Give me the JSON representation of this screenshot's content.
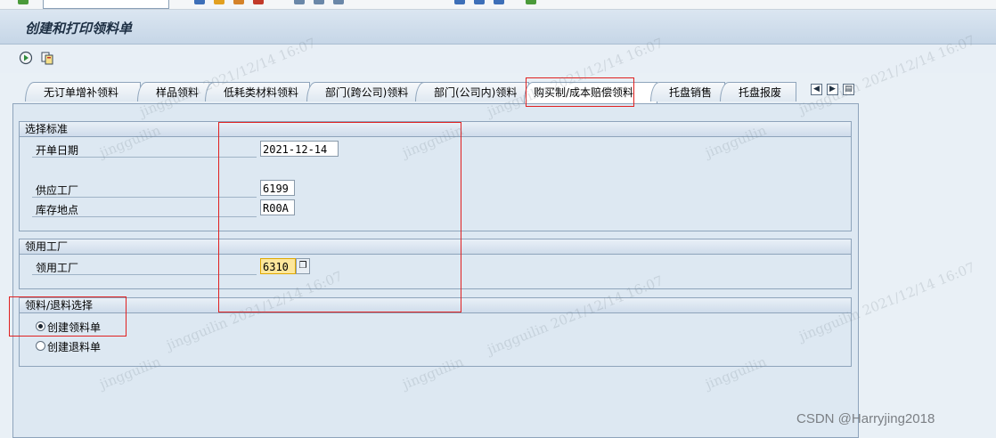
{
  "window": {
    "title": "创建和打印领料单"
  },
  "tabs": [
    {
      "label": "无订单增补领料"
    },
    {
      "label": "样品领料"
    },
    {
      "label": "低耗类材料领料"
    },
    {
      "label": "部门(跨公司)领料"
    },
    {
      "label": "部门(公司内)领料"
    },
    {
      "label": "购买制/成本赔偿领料"
    },
    {
      "label": "托盘销售"
    },
    {
      "label": "托盘报废"
    }
  ],
  "selection": {
    "header": "选择标准",
    "open_date_label": "开单日期",
    "open_date_value": "2021-12-14",
    "supply_plant_label": "供应工厂",
    "supply_plant_value": "6199",
    "storage_loc_label": "库存地点",
    "storage_loc_value": "R00A"
  },
  "receiving": {
    "header": "领用工厂",
    "plant_label": "领用工厂",
    "plant_value": "6310"
  },
  "mode": {
    "header": "领料/退料选择",
    "option_create_issue": "创建领料单",
    "option_create_return": "创建退料单",
    "selected": "create_issue"
  },
  "watermark": {
    "line1": "jingguilin 2021/12/14 16:07",
    "line2": "jingguilin"
  },
  "credit": "CSDN @Harryjing2018",
  "colors": {
    "highlight_red": "#e02020",
    "focus_yellow": "#fde69b"
  }
}
